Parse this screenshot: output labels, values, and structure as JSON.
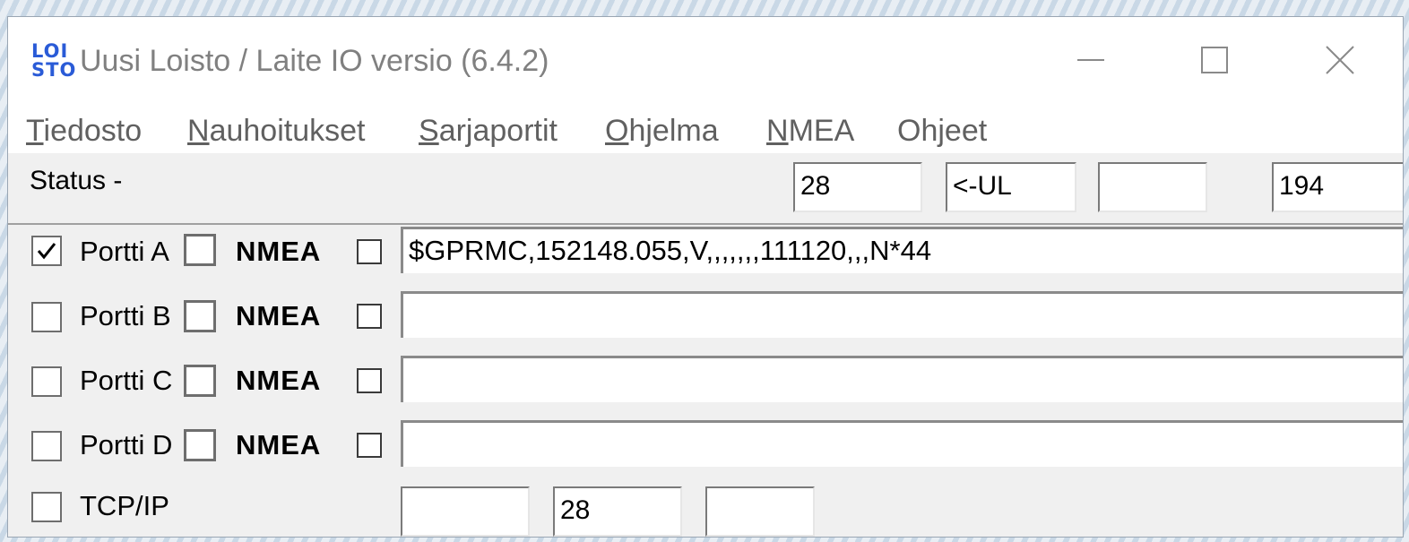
{
  "window": {
    "logo_text": "LOI STO",
    "title": "Uusi Loisto / Laite IO versio (6.4.2)"
  },
  "menu": [
    {
      "mnemonic": "T",
      "rest": "iedosto"
    },
    {
      "mnemonic": "N",
      "rest": "auhoitukset"
    },
    {
      "mnemonic": "S",
      "rest": "arjaportit"
    },
    {
      "mnemonic": "O",
      "rest": "hjelma"
    },
    {
      "mnemonic": "N",
      "rest": "MEA"
    },
    {
      "mnemonic": "",
      "rest": "Ohjeet"
    }
  ],
  "status": {
    "label": "Status -",
    "field1": "28",
    "field2": "<-UL",
    "field3": "",
    "field4": "194"
  },
  "ports": [
    {
      "label": "Portti A",
      "enabled": true,
      "nmea_label": "NMEA",
      "sentence": "$GPRMC,152148.055,V,,,,,,,111120,,,N*44"
    },
    {
      "label": "Portti B",
      "enabled": false,
      "nmea_label": "NMEA",
      "sentence": ""
    },
    {
      "label": "Portti C",
      "enabled": false,
      "nmea_label": "NMEA",
      "sentence": ""
    },
    {
      "label": "Portti D",
      "enabled": false,
      "nmea_label": "NMEA",
      "sentence": ""
    }
  ],
  "tcp": {
    "label": "TCP/IP",
    "enabled": false,
    "field1": "",
    "field2": "28",
    "field3": ""
  },
  "icons": {
    "check": "check-mark",
    "minimize": "minimize-icon",
    "maximize": "maximize-icon",
    "close": "close-icon"
  }
}
